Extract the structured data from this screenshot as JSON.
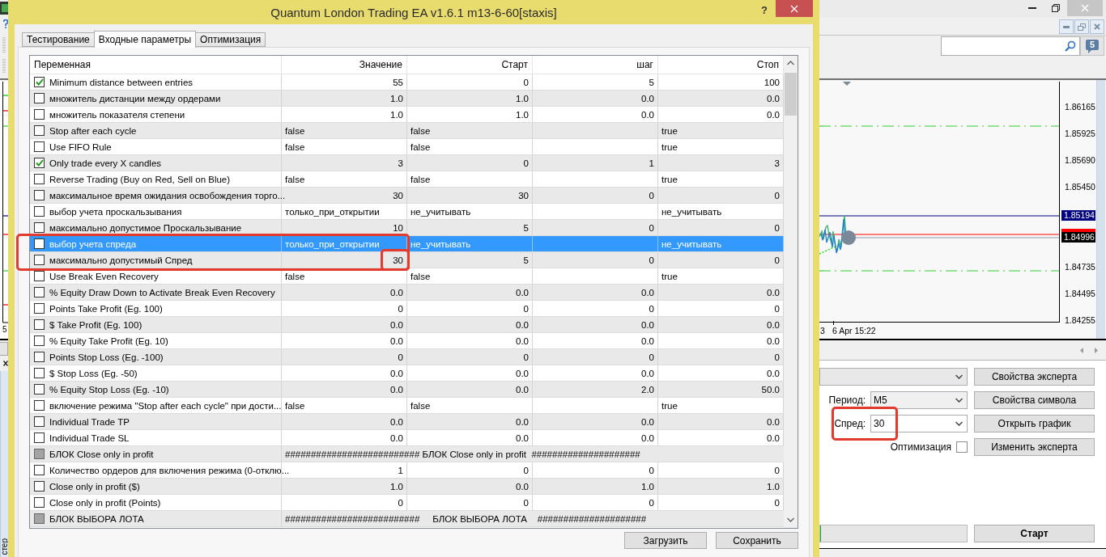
{
  "window": {
    "title": "Quantum London Trading EA v1.6.1 m13-6-60[staxis]",
    "help": "?"
  },
  "tabs": [
    {
      "label": "Тестирование",
      "selected": false
    },
    {
      "label": "Входные параметры",
      "selected": true
    },
    {
      "label": "Оптимизация",
      "selected": false
    }
  ],
  "table": {
    "columns": [
      "Переменная",
      "Значение",
      "Старт",
      "шаг",
      "Стоп"
    ],
    "rows": [
      {
        "kind": "number",
        "checked": true,
        "disabled": false,
        "selected": false,
        "name": "Minimum distance between entries",
        "value": "55",
        "start": "0",
        "step": "5",
        "stop": "100"
      },
      {
        "kind": "number",
        "checked": false,
        "disabled": false,
        "selected": false,
        "name": "множитель дистанции между ордерами",
        "value": "1.0",
        "start": "1.0",
        "step": "0.0",
        "stop": "0.0"
      },
      {
        "kind": "number",
        "checked": false,
        "disabled": false,
        "selected": false,
        "name": "множитель показателя степени",
        "value": "1.0",
        "start": "1.0",
        "step": "0.0",
        "stop": "0.0"
      },
      {
        "kind": "text",
        "checked": false,
        "disabled": false,
        "selected": false,
        "name": "Stop after each cycle",
        "value": "false",
        "start": "false",
        "stop": "true"
      },
      {
        "kind": "text",
        "checked": false,
        "disabled": false,
        "selected": false,
        "name": "Use FIFO Rule",
        "value": "false",
        "start": "false",
        "stop": "true"
      },
      {
        "kind": "number",
        "checked": true,
        "disabled": false,
        "selected": false,
        "name": "Only trade every X candles",
        "value": "3",
        "start": "0",
        "step": "1",
        "stop": "3"
      },
      {
        "kind": "text",
        "checked": false,
        "disabled": false,
        "selected": false,
        "name": "Reverse Trading (Buy on Red, Sell on Blue)",
        "value": "false",
        "start": "false",
        "stop": "true"
      },
      {
        "kind": "number",
        "checked": false,
        "disabled": false,
        "selected": false,
        "name": "максимальное время ожидания освобождения торго...",
        "value": "30",
        "start": "30",
        "step": "0",
        "stop": "0"
      },
      {
        "kind": "text",
        "checked": false,
        "disabled": false,
        "selected": false,
        "name": "выбор учета проскальзывания",
        "value": "только_при_открытии",
        "start": "не_учитывать",
        "stop": "не_учитывать"
      },
      {
        "kind": "number",
        "checked": false,
        "disabled": false,
        "selected": false,
        "name": "максимально допустимое Проскальзывание",
        "value": "10",
        "start": "5",
        "step": "0",
        "stop": "0"
      },
      {
        "kind": "text",
        "checked": false,
        "disabled": false,
        "selected": true,
        "name": "выбор учета спреда",
        "value": "только_при_открытии",
        "start": "не_учитывать",
        "stop": "не_учитывать"
      },
      {
        "kind": "number",
        "checked": false,
        "disabled": false,
        "selected": false,
        "name": "максимально допустимый Спред",
        "value": "30",
        "start": "5",
        "step": "0",
        "stop": "0"
      },
      {
        "kind": "text",
        "checked": false,
        "disabled": false,
        "selected": false,
        "name": "Use Break Even Recovery",
        "value": "false",
        "start": "false",
        "stop": "true"
      },
      {
        "kind": "number",
        "checked": false,
        "disabled": false,
        "selected": false,
        "name": "% Equity Draw Down to Activate Break Even Recovery",
        "value": "0.0",
        "start": "0.0",
        "step": "0.0",
        "stop": "0.0"
      },
      {
        "kind": "number",
        "checked": false,
        "disabled": false,
        "selected": false,
        "name": "Points Take Profit (Eg. 100)",
        "value": "0",
        "start": "0",
        "step": "0",
        "stop": "0"
      },
      {
        "kind": "number",
        "checked": false,
        "disabled": false,
        "selected": false,
        "name": "$ Take Profit (Eg. 100)",
        "value": "0.0",
        "start": "0.0",
        "step": "0.0",
        "stop": "0.0"
      },
      {
        "kind": "number",
        "checked": false,
        "disabled": false,
        "selected": false,
        "name": "% Equity Take Profit (Eg. 10)",
        "value": "0.0",
        "start": "0.0",
        "step": "0.0",
        "stop": "0.0"
      },
      {
        "kind": "number",
        "checked": false,
        "disabled": false,
        "selected": false,
        "name": "Points Stop Loss (Eg. -100)",
        "value": "0",
        "start": "0",
        "step": "0",
        "stop": "0"
      },
      {
        "kind": "number",
        "checked": false,
        "disabled": false,
        "selected": false,
        "name": "$ Stop Loss (Eg. -50)",
        "value": "0.0",
        "start": "0.0",
        "step": "0.0",
        "stop": "0.0"
      },
      {
        "kind": "number",
        "checked": false,
        "disabled": false,
        "selected": false,
        "name": "% Equity Stop Loss (Eg. -10)",
        "value": "0.0",
        "start": "0.0",
        "step": "2.0",
        "stop": "50.0"
      },
      {
        "kind": "text",
        "checked": false,
        "disabled": false,
        "selected": false,
        "name": "включение режима \"Stop after each cycle\" при дости...",
        "value": "false",
        "start": "false",
        "stop": "true"
      },
      {
        "kind": "number",
        "checked": false,
        "disabled": false,
        "selected": false,
        "name": "Individual Trade TP",
        "value": "0.0",
        "start": "0.0",
        "step": "0.0",
        "stop": "0.0"
      },
      {
        "kind": "number",
        "checked": false,
        "disabled": false,
        "selected": false,
        "name": "Individual Trade SL",
        "value": "0.0",
        "start": "0.0",
        "step": "0.0",
        "stop": "0.0"
      },
      {
        "kind": "separator",
        "checked": false,
        "disabled": true,
        "selected": false,
        "name": "БЛОК Close only in profit",
        "value": "########################## БЛОК Close only in profit  #####################"
      },
      {
        "kind": "number",
        "checked": false,
        "disabled": false,
        "selected": false,
        "name": "Количество ордеров для включения режима (0-отклю...",
        "value": "1",
        "start": "0",
        "step": "0",
        "stop": "0"
      },
      {
        "kind": "number",
        "checked": false,
        "disabled": false,
        "selected": false,
        "name": "Close only in profit ($)",
        "value": "1.0",
        "start": "0.0",
        "step": "1.0",
        "stop": "1.0"
      },
      {
        "kind": "number",
        "checked": false,
        "disabled": false,
        "selected": false,
        "name": "Close only in profit (Points)",
        "value": "0",
        "start": "0",
        "step": "0",
        "stop": "0"
      },
      {
        "kind": "separator",
        "checked": false,
        "disabled": true,
        "selected": false,
        "name": "БЛОК ВЫБОРА ЛОТА",
        "value": "##########################     БЛОК ВЫБОРА ЛОТА    #####################"
      }
    ]
  },
  "buttons": [
    "Загрузить",
    "Сохранить"
  ],
  "terminal": {
    "left_strip": {
      "axis_label": "5",
      "panel_label": "стер"
    },
    "message_count": "5",
    "chart": {
      "price_labels": [
        "1.86165",
        "1.85925",
        "1.85690",
        "1.85450",
        "1.84735",
        "1.84495",
        "1.84255"
      ],
      "bid_label": "1.85194",
      "ask_label": "1.84996",
      "time_labels": [
        "3",
        "6 Apr 15:22"
      ]
    },
    "tester": {
      "expert_select": {
        "disabled": true
      },
      "period": {
        "label": "Период:",
        "value": "M5"
      },
      "spread": {
        "label": "Спред:",
        "value": "30"
      },
      "optimization": {
        "label": "Оптимизация",
        "checked": false
      },
      "side_buttons": [
        "Свойства эксперта",
        "Свойства символа",
        "Открыть график",
        "Изменить эксперта"
      ],
      "progress": {
        "level": 0
      },
      "start_button": "Старт"
    }
  }
}
